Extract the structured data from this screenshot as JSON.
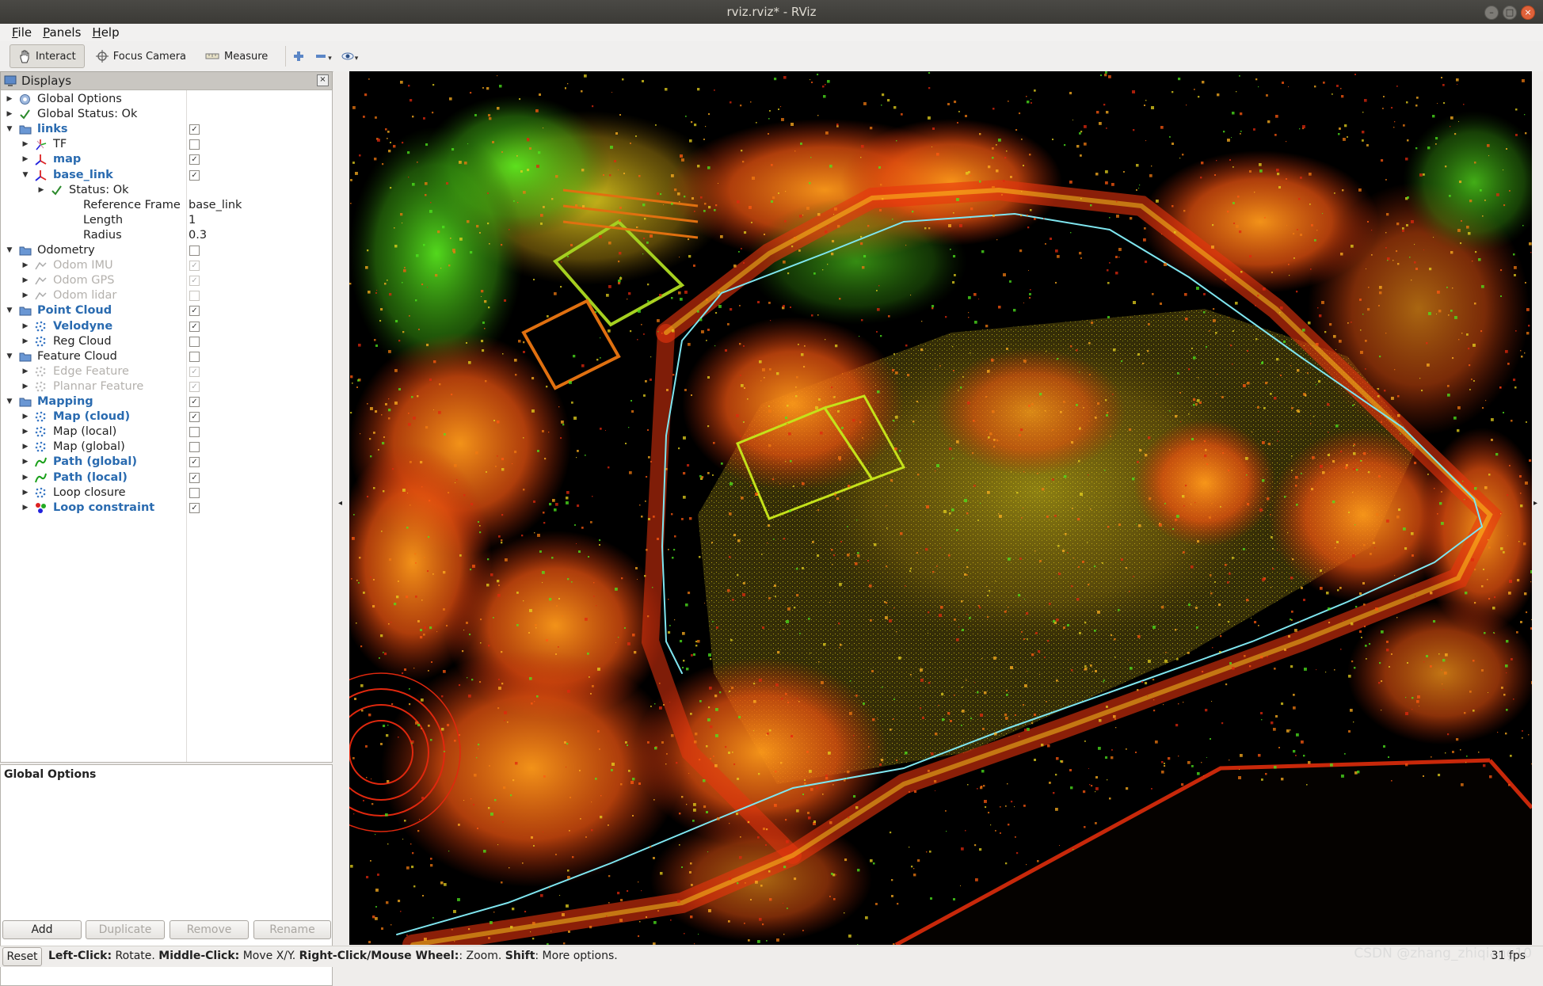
{
  "window": {
    "title": "rviz.rviz* - RViz"
  },
  "menu": [
    {
      "label": "File",
      "key": "F",
      "rest": "ile"
    },
    {
      "label": "Panels",
      "key": "P",
      "rest": "anels"
    },
    {
      "label": "Help",
      "key": "H",
      "rest": "elp"
    }
  ],
  "toolbar": {
    "interact": "Interact",
    "focus_camera": "Focus Camera",
    "measure": "Measure"
  },
  "displays": {
    "title": "Displays",
    "rows": [
      {
        "label": "Global Options",
        "indent": 0,
        "arrow": "right",
        "icon": "gear",
        "style": ""
      },
      {
        "label": "Global Status: Ok",
        "indent": 0,
        "arrow": "right",
        "icon": "check",
        "style": ""
      },
      {
        "label": "links",
        "indent": 0,
        "arrow": "down",
        "icon": "folder",
        "style": "blue",
        "check": "on"
      },
      {
        "label": "TF",
        "indent": 1,
        "arrow": "right",
        "icon": "tf",
        "style": "",
        "check": "off"
      },
      {
        "label": "map",
        "indent": 1,
        "arrow": "right",
        "icon": "axes",
        "style": "blue",
        "check": "on"
      },
      {
        "label": "base_link",
        "indent": 1,
        "arrow": "down",
        "icon": "axes",
        "style": "blue",
        "check": "on"
      },
      {
        "label": "Status: Ok",
        "indent": 2,
        "arrow": "right",
        "icon": "check",
        "style": ""
      },
      {
        "label": "Reference Frame",
        "indent": 2,
        "arrow": "none",
        "icon": "none",
        "style": "",
        "value": "base_link"
      },
      {
        "label": "Length",
        "indent": 2,
        "arrow": "none",
        "icon": "none",
        "style": "",
        "value": "1"
      },
      {
        "label": "Radius",
        "indent": 2,
        "arrow": "none",
        "icon": "none",
        "style": "",
        "value": "0.3"
      },
      {
        "label": "Odometry",
        "indent": 0,
        "arrow": "down",
        "icon": "folder",
        "style": "",
        "check": "off"
      },
      {
        "label": "Odom IMU",
        "indent": 1,
        "arrow": "right",
        "icon": "odom",
        "style": "gray",
        "check": "dis-on"
      },
      {
        "label": "Odom GPS",
        "indent": 1,
        "arrow": "right",
        "icon": "odom",
        "style": "gray",
        "check": "dis-on"
      },
      {
        "label": "Odom lidar",
        "indent": 1,
        "arrow": "right",
        "icon": "odom",
        "style": "gray",
        "check": "dis-off"
      },
      {
        "label": "Point Cloud",
        "indent": 0,
        "arrow": "down",
        "icon": "folder",
        "style": "blue",
        "check": "on"
      },
      {
        "label": "Velodyne",
        "indent": 1,
        "arrow": "right",
        "icon": "cloud",
        "style": "blue",
        "check": "on"
      },
      {
        "label": "Reg Cloud",
        "indent": 1,
        "arrow": "right",
        "icon": "cloud",
        "style": "",
        "check": "off"
      },
      {
        "label": "Feature Cloud",
        "indent": 0,
        "arrow": "down",
        "icon": "folder",
        "style": "",
        "check": "off"
      },
      {
        "label": "Edge Feature",
        "indent": 1,
        "arrow": "right",
        "icon": "cloud-gray",
        "style": "gray",
        "check": "dis-on"
      },
      {
        "label": "Plannar Feature",
        "indent": 1,
        "arrow": "right",
        "icon": "cloud-gray",
        "style": "gray",
        "check": "dis-on"
      },
      {
        "label": "Mapping",
        "indent": 0,
        "arrow": "down",
        "icon": "folder",
        "style": "blue",
        "check": "on"
      },
      {
        "label": "Map (cloud)",
        "indent": 1,
        "arrow": "right",
        "icon": "cloud",
        "style": "blue",
        "check": "on"
      },
      {
        "label": "Map (local)",
        "indent": 1,
        "arrow": "right",
        "icon": "cloud",
        "style": "",
        "check": "off"
      },
      {
        "label": "Map (global)",
        "indent": 1,
        "arrow": "right",
        "icon": "cloud",
        "style": "",
        "check": "off"
      },
      {
        "label": "Path (global)",
        "indent": 1,
        "arrow": "right",
        "icon": "path",
        "style": "blue",
        "check": "on"
      },
      {
        "label": "Path (local)",
        "indent": 1,
        "arrow": "right",
        "icon": "path",
        "style": "blue",
        "check": "on"
      },
      {
        "label": "Loop closure",
        "indent": 1,
        "arrow": "right",
        "icon": "cloud",
        "style": "",
        "check": "off"
      },
      {
        "label": "Loop constraint",
        "indent": 1,
        "arrow": "right",
        "icon": "marker",
        "style": "blue",
        "check": "on"
      }
    ]
  },
  "properties": {
    "title": "Global Options"
  },
  "buttons": {
    "add": "Add",
    "duplicate": "Duplicate",
    "remove": "Remove",
    "rename": "Rename"
  },
  "status": {
    "reset": "Reset",
    "hint_parts": [
      {
        "t": "Left-Click:",
        "b": true
      },
      {
        "t": " Rotate. ",
        "b": false
      },
      {
        "t": "Middle-Click:",
        "b": true
      },
      {
        "t": " Move X/Y. ",
        "b": false
      },
      {
        "t": "Right-Click/Mouse Wheel:",
        "b": true
      },
      {
        "t": ": Zoom. ",
        "b": false
      },
      {
        "t": "Shift",
        "b": true
      },
      {
        "t": ": More options.",
        "b": false
      }
    ],
    "fps": "31 fps",
    "watermark": "CSDN @zhang_zhiqiang10"
  },
  "colors": {
    "accent_blue": "#2a6bb0",
    "cloud_red": "#e0280e",
    "cloud_orange": "#f07a10",
    "cloud_yellow": "#e6d21e",
    "cloud_green": "#4ee61e",
    "path_cyan": "#7fe6f0"
  }
}
